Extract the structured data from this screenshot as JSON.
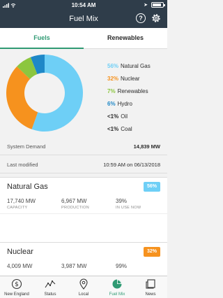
{
  "status_bar": {
    "time": "10:54 AM"
  },
  "nav": {
    "title": "Fuel Mix",
    "help_glyph": "?"
  },
  "tabs": [
    {
      "label": "Fuels",
      "active": true
    },
    {
      "label": "Renewables",
      "active": false
    }
  ],
  "chart_data": {
    "type": "pie",
    "style": "donut",
    "slices": [
      {
        "label": "Natural Gas",
        "pct_label": "56%",
        "value": 56,
        "color": "#6ecff6"
      },
      {
        "label": "Nuclear",
        "pct_label": "32%",
        "value": 32,
        "color": "#f6921e"
      },
      {
        "label": "Renewables",
        "pct_label": "7%",
        "value": 7,
        "color": "#8cc63f"
      },
      {
        "label": "Hydro",
        "pct_label": "6%",
        "value": 6,
        "color": "#1f88c7"
      },
      {
        "label": "Oil",
        "pct_label": "<1%",
        "value": 0,
        "color": "#2b2b2b"
      },
      {
        "label": "Coal",
        "pct_label": "<1%",
        "value": 0,
        "color": "#2b2b2b"
      }
    ]
  },
  "summary": {
    "demand_label": "System Demand",
    "demand_value": "14,839 MW",
    "modified_label": "Last modified",
    "modified_value": "10:59 AM on 06/13/2018"
  },
  "fuels": [
    {
      "name": "Natural Gas",
      "badge": "56%",
      "badge_color": "#6ecff6",
      "capacity": "17,740 MW",
      "production": "6,967 MW",
      "in_use": "39%",
      "capacity_label": "CAPACITY",
      "production_label": "PRODUCTION",
      "in_use_label": "IN USE NOW"
    },
    {
      "name": "Nuclear",
      "badge": "32%",
      "badge_color": "#f6921e",
      "capacity": "4,009 MW",
      "production": "3,987 MW",
      "in_use": "99%"
    }
  ],
  "bottom_nav": [
    {
      "label": "New England",
      "icon": "dollar-icon"
    },
    {
      "label": "Status",
      "icon": "trend-icon"
    },
    {
      "label": "Local",
      "icon": "location-pin-icon"
    },
    {
      "label": "Fuel Mix",
      "icon": "pie-icon",
      "active": true
    },
    {
      "label": "News",
      "icon": "news-icon"
    }
  ],
  "colors": {
    "accent": "#2f9a73",
    "header": "#2f3d4a"
  }
}
